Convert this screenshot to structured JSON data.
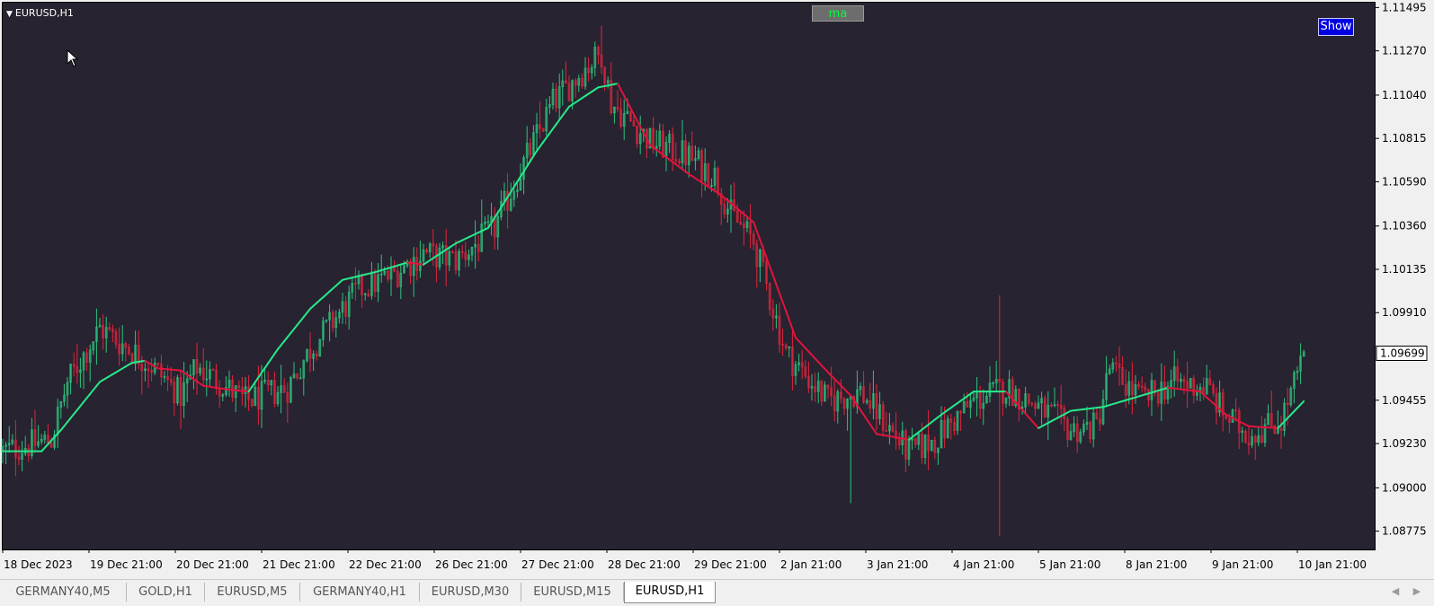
{
  "window": {
    "symbol_caption": "EURUSD,H1"
  },
  "buttons": {
    "ma_label": "ma",
    "show_label": "Show"
  },
  "colors": {
    "background": "#272330",
    "bull_candle": "#2ec27e",
    "bear_candle": "#e0243c",
    "ma_up": "#27e88a",
    "ma_down": "#e0143c",
    "axis_text": "#000000"
  },
  "icons": {
    "collapse": "triangle-down-icon",
    "cursor": "mouse-pointer-icon",
    "left": "arrow-left-icon",
    "right": "arrow-right-icon"
  },
  "tabs": [
    {
      "label": "GERMANY40,M5",
      "active": false
    },
    {
      "label": "GOLD,H1",
      "active": false
    },
    {
      "label": "EURUSD,M5",
      "active": false
    },
    {
      "label": "GERMANY40,H1",
      "active": false
    },
    {
      "label": "EURUSD,M30",
      "active": false
    },
    {
      "label": "EURUSD,M15",
      "active": false
    },
    {
      "label": "EURUSD,H1",
      "active": true
    }
  ],
  "chart_data": {
    "type": "candlestick",
    "symbol": "EURUSD",
    "timeframe": "H1",
    "ylim": [
      1.0868,
      1.1152
    ],
    "y_ticks": [
      "1.11495",
      "1.11270",
      "1.11040",
      "1.10815",
      "1.10590",
      "1.10360",
      "1.10135",
      "1.09910",
      "1.09455",
      "1.09230",
      "1.09000",
      "1.08775"
    ],
    "current_price": "1.09699",
    "x_ticks": [
      "18 Dec 2023",
      "19 Dec 21:00",
      "20 Dec 21:00",
      "21 Dec 21:00",
      "22 Dec 21:00",
      "26 Dec 21:00",
      "27 Dec 21:00",
      "28 Dec 21:00",
      "29 Dec 21:00",
      "2 Jan 21:00",
      "3 Jan 21:00",
      "4 Jan 21:00",
      "5 Jan 21:00",
      "8 Jan 21:00",
      "9 Jan 21:00",
      "10 Jan 21:00"
    ],
    "bar_count": 350,
    "price_path": [
      [
        0,
        1.0919
      ],
      [
        15,
        1.0925
      ],
      [
        20,
        1.0955
      ],
      [
        30,
        1.0983
      ],
      [
        45,
        1.0965
      ],
      [
        55,
        1.0948
      ],
      [
        60,
        1.0963
      ],
      [
        75,
        1.0945
      ],
      [
        88,
        1.0952
      ],
      [
        95,
        1.0972
      ],
      [
        110,
        1.1003
      ],
      [
        120,
        1.101
      ],
      [
        130,
        1.1022
      ],
      [
        140,
        1.1018
      ],
      [
        152,
        1.1035
      ],
      [
        160,
        1.1065
      ],
      [
        170,
        1.11
      ],
      [
        180,
        1.1118
      ],
      [
        185,
        1.1126
      ],
      [
        188,
        1.11
      ],
      [
        200,
        1.108
      ],
      [
        212,
        1.1072
      ],
      [
        220,
        1.1062
      ],
      [
        225,
        1.1042
      ],
      [
        232,
        1.1028
      ],
      [
        242,
        1.097
      ],
      [
        255,
        1.0945
      ],
      [
        265,
        1.095
      ],
      [
        272,
        1.0935
      ],
      [
        280,
        1.0918
      ],
      [
        288,
        1.0925
      ],
      [
        300,
        1.0945
      ],
      [
        310,
        1.0952
      ],
      [
        322,
        1.094
      ],
      [
        330,
        1.093
      ],
      [
        338,
        1.0932
      ],
      [
        342,
        1.0962
      ],
      [
        352,
        1.0946
      ],
      [
        362,
        1.0955
      ],
      [
        372,
        1.0952
      ],
      [
        378,
        1.0937
      ],
      [
        385,
        1.0928
      ],
      [
        395,
        1.0935
      ],
      [
        402,
        1.0968
      ]
    ],
    "ma_path": [
      [
        0,
        1.0919
      ],
      [
        12,
        1.0919
      ],
      [
        18,
        1.093
      ],
      [
        30,
        1.0955
      ],
      [
        40,
        1.0965
      ],
      [
        44,
        1.0966
      ],
      [
        48,
        1.0962
      ],
      [
        55,
        1.0961
      ],
      [
        62,
        1.0953
      ],
      [
        70,
        1.0951
      ],
      [
        76,
        1.095
      ],
      [
        85,
        1.0972
      ],
      [
        95,
        1.0993
      ],
      [
        105,
        1.1008
      ],
      [
        115,
        1.1012
      ],
      [
        125,
        1.1017
      ],
      [
        130,
        1.1016
      ],
      [
        140,
        1.1027
      ],
      [
        150,
        1.1035
      ],
      [
        165,
        1.1075
      ],
      [
        175,
        1.1098
      ],
      [
        184,
        1.1108
      ],
      [
        190,
        1.111
      ],
      [
        200,
        1.1078
      ],
      [
        212,
        1.1063
      ],
      [
        222,
        1.1052
      ],
      [
        232,
        1.1038
      ],
      [
        245,
        1.0978
      ],
      [
        255,
        1.096
      ],
      [
        262,
        1.0948
      ],
      [
        270,
        1.0928
      ],
      [
        280,
        1.0925
      ],
      [
        290,
        1.0938
      ],
      [
        300,
        1.095
      ],
      [
        310,
        1.095
      ],
      [
        320,
        1.0931
      ],
      [
        330,
        1.094
      ],
      [
        340,
        1.0942
      ],
      [
        350,
        1.0947
      ],
      [
        360,
        1.0952
      ],
      [
        370,
        1.095
      ],
      [
        378,
        1.0938
      ],
      [
        385,
        1.0932
      ],
      [
        394,
        1.0931
      ],
      [
        402,
        1.0945
      ]
    ]
  }
}
